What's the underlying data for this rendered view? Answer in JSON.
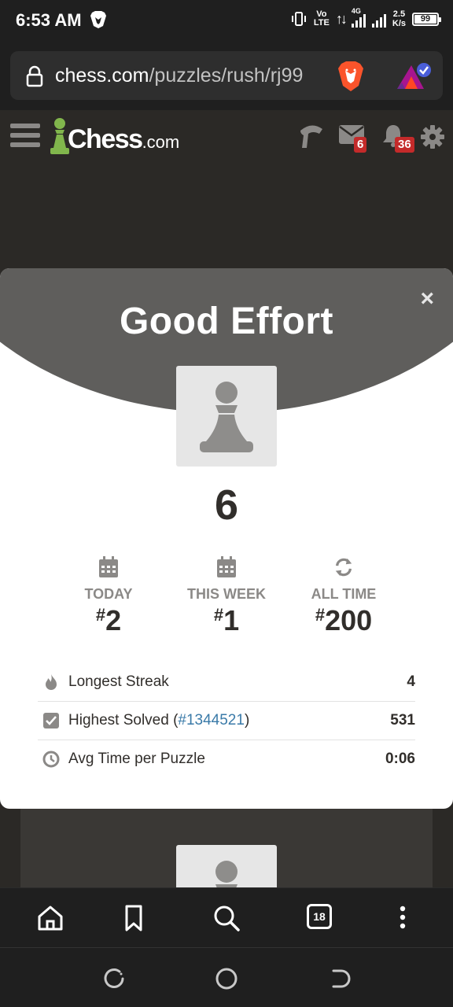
{
  "status_bar": {
    "time": "6:53 AM",
    "volte_top": "Vo",
    "volte_bottom": "LTE",
    "network": "4G",
    "speed_value": "2.5",
    "speed_unit": "K/s",
    "battery": "99"
  },
  "browser": {
    "url_domain": "chess.com",
    "url_path": "/puzzles/rush/rj99",
    "tabs_count": "18"
  },
  "header": {
    "logo_main": "Chess",
    "logo_suffix": ".com",
    "messages_badge": "6",
    "notifications_badge": "36"
  },
  "modal": {
    "title": "Good Effort",
    "close": "×",
    "score": "6",
    "ranks": [
      {
        "label": "TODAY",
        "hash": "#",
        "value": "2"
      },
      {
        "label": "THIS WEEK",
        "hash": "#",
        "value": "1"
      },
      {
        "label": "ALL TIME",
        "hash": "#",
        "value": "200"
      }
    ],
    "stats": [
      {
        "label": "Longest Streak",
        "value": "4"
      },
      {
        "label_prefix": "Highest Solved (",
        "link": "#1344521",
        "label_suffix": ")",
        "value": "531"
      },
      {
        "label": "Avg Time per Puzzle",
        "value": "0:06"
      }
    ]
  },
  "colors": {
    "accent_green": "#81b64c",
    "badge_red": "#c42a2a",
    "link_blue": "#3a7aa8",
    "modal_header": "#5f5e5c"
  }
}
